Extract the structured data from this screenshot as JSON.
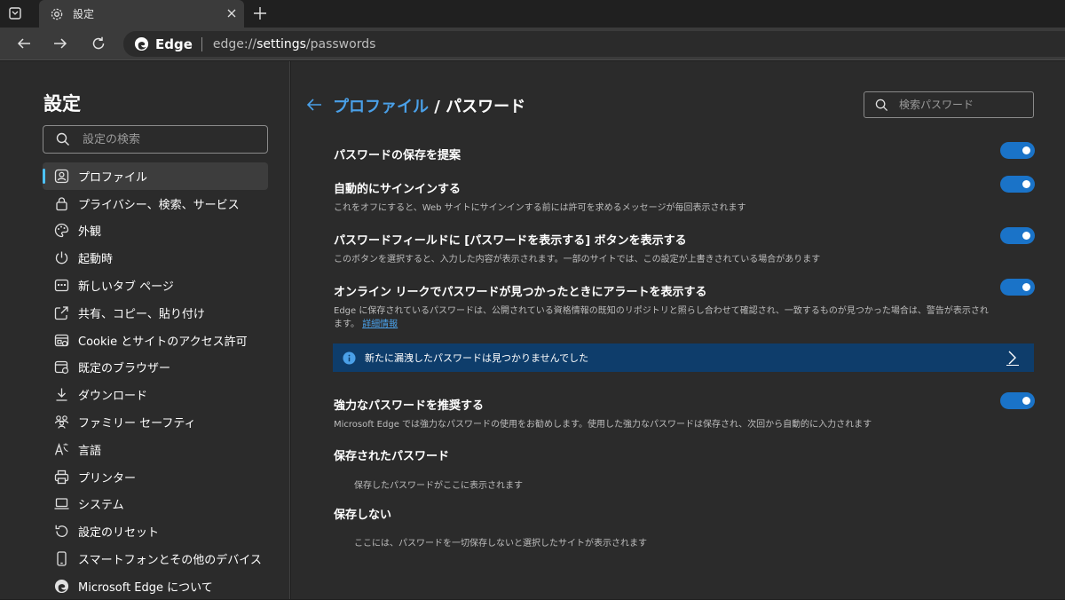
{
  "browser": {
    "tab_title": "設定",
    "brand": "Edge",
    "url_prefix": "edge://",
    "url_host": "settings",
    "url_path": "/passwords"
  },
  "sidebar": {
    "title": "設定",
    "search_placeholder": "設定の検索",
    "items": [
      {
        "label": "プロファイル",
        "icon": "profile-icon",
        "active": true
      },
      {
        "label": "プライバシー、検索、サービス",
        "icon": "lock-icon"
      },
      {
        "label": "外観",
        "icon": "palette-icon"
      },
      {
        "label": "起動時",
        "icon": "power-icon"
      },
      {
        "label": "新しいタブ ページ",
        "icon": "new-tab-page-icon"
      },
      {
        "label": "共有、コピー、貼り付け",
        "icon": "share-icon"
      },
      {
        "label": "Cookie とサイトのアクセス許可",
        "icon": "site-permissions-icon"
      },
      {
        "label": "既定のブラウザー",
        "icon": "default-browser-icon"
      },
      {
        "label": "ダウンロード",
        "icon": "download-icon"
      },
      {
        "label": "ファミリー セーフティ",
        "icon": "family-icon"
      },
      {
        "label": "言語",
        "icon": "language-icon"
      },
      {
        "label": "プリンター",
        "icon": "printer-icon"
      },
      {
        "label": "システム",
        "icon": "laptop-icon"
      },
      {
        "label": "設定のリセット",
        "icon": "reset-icon"
      },
      {
        "label": "スマートフォンとその他のデバイス",
        "icon": "phone-icon"
      },
      {
        "label": "Microsoft Edge について",
        "icon": "edge-logo-icon"
      }
    ]
  },
  "main": {
    "breadcrumb_parent": "プロファイル",
    "breadcrumb_sep": " / ",
    "breadcrumb_current": "パスワード",
    "search_placeholder": "検索パスワード",
    "settings": [
      {
        "title": "パスワードの保存を提案",
        "desc": "",
        "enabled": true
      },
      {
        "title": "自動的にサインインする",
        "desc": "これをオフにすると、Web サイトにサインインする前には許可を求めるメッセージが毎回表示されます",
        "enabled": true
      },
      {
        "title": "パスワードフィールドに [パスワードを表示する] ボタンを表示する",
        "desc": "このボタンを選択すると、入力した内容が表示されます。一部のサイトでは、この設定が上書きされている場合があります",
        "enabled": true
      },
      {
        "title": "オンライン リークでパスワードが見つかったときにアラートを表示する",
        "desc": "Edge に保存されているパスワードは、公開されている資格情報の既知のリポジトリと照らし合わせて確認され、一致するものが見つかった場合は、警告が表示されます。",
        "link": "詳細情報",
        "enabled": true
      },
      {
        "title": "強力なパスワードを推奨する",
        "desc": "Microsoft Edge では強力なパスワードの使用をお勧めします。使用した強力なパスワードは保存され、次回から自動的に入力されます",
        "enabled": true
      }
    ],
    "leak_banner": "新たに漏洩したパスワードは見つかりませんでした",
    "saved_title": "保存されたパスワード",
    "saved_empty": "保存したパスワードがここに表示されます",
    "never_title": "保存しない",
    "never_empty": "ここには、パスワードを一切保存しないと選択したサイトが表示されます"
  },
  "colors": {
    "accent": "#4aa0e8",
    "toggle_on": "#1a73c8",
    "banner": "#0e3d6b"
  }
}
